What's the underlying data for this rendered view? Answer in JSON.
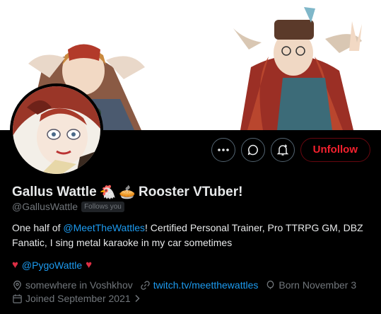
{
  "profile": {
    "display_name": "Gallus Wattle",
    "name_suffix": "Rooster VTuber!",
    "emoji_1": "🐔",
    "emoji_2": "🥧",
    "handle": "@GallusWattle",
    "follows_you": "Follows you",
    "bio_prefix": "One half of ",
    "bio_mention": "@MeetTheWattles",
    "bio_suffix": "! Certified Personal Trainer, Pro TTRPG GM, DBZ Fanatic, I sing metal karaoke in my car sometimes",
    "heart": "♥",
    "partner_handle": "@PygoWattle",
    "location": "somewhere in Voshkhov",
    "website": "twitch.tv/meetthewattles",
    "birthday": "Born November 3",
    "joined": "Joined September 2021"
  },
  "actions": {
    "unfollow_label": "Unfollow"
  },
  "colors": {
    "accent": "#1d9bf0",
    "unfollow": "#f4212e",
    "heart": "#dd2e44",
    "muted": "#71767b"
  },
  "icons": [
    "more-icon",
    "message-icon",
    "notification-bell-icon",
    "location-icon",
    "link-icon",
    "balloon-icon",
    "chevron-right-icon"
  ]
}
